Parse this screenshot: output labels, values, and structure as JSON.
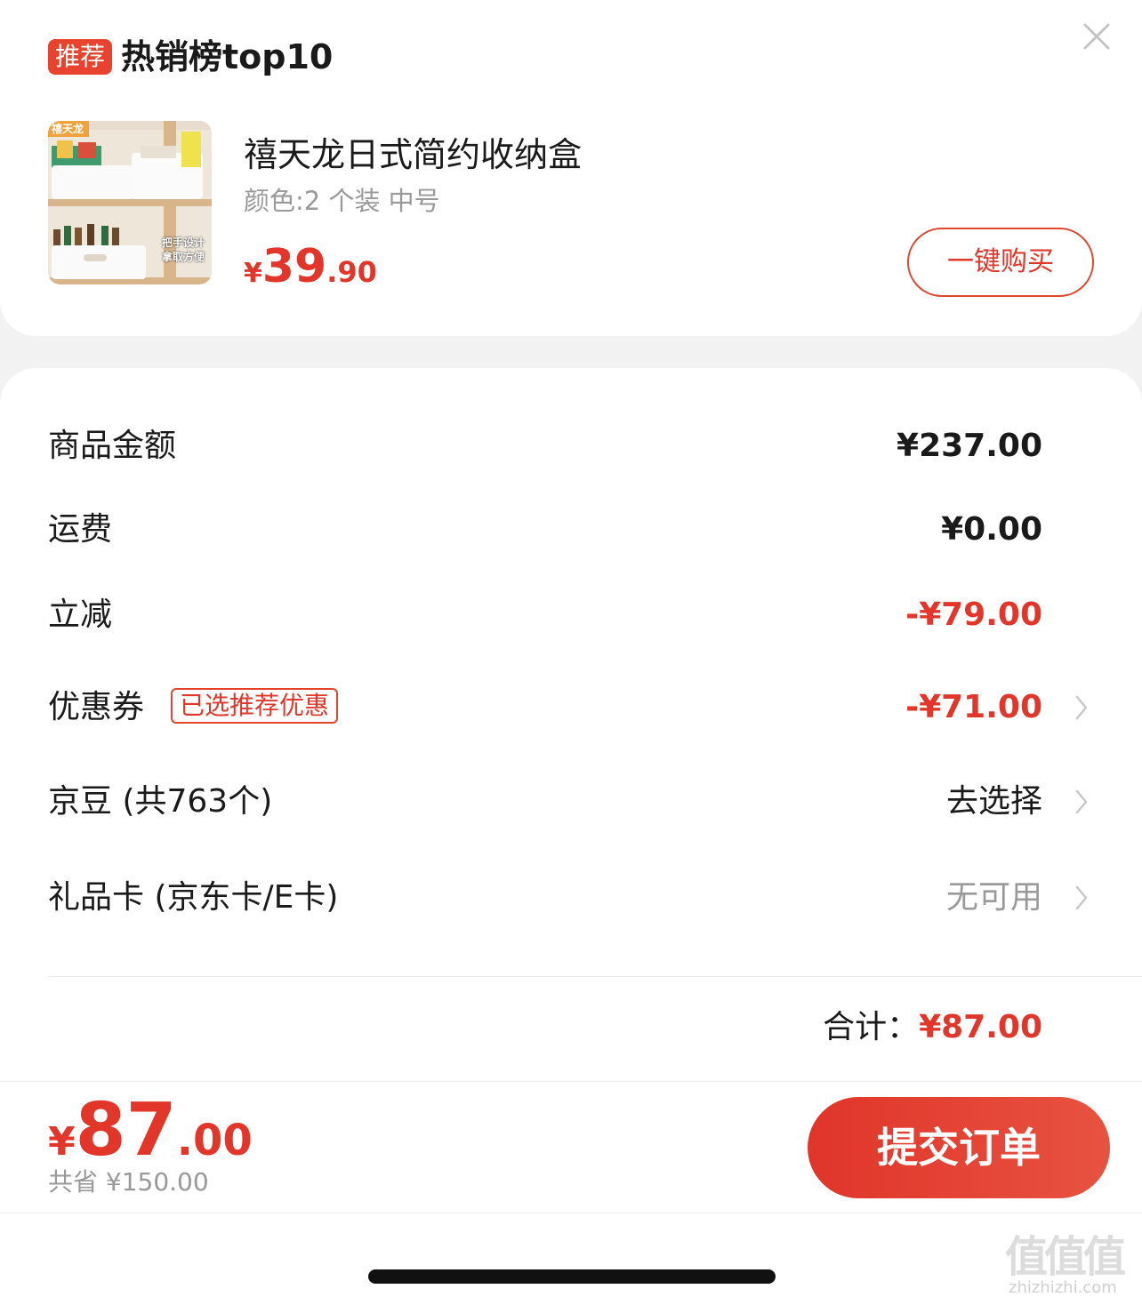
{
  "recommend": {
    "badge": "推荐",
    "title": "热销榜top10",
    "close_icon": "close-icon",
    "product": {
      "name": "禧天龙日式简约收纳盒",
      "spec": "颜色:2 个装  中号",
      "price_currency": "¥",
      "price_int": "39",
      "price_dec": ".90",
      "buy_label": "一键购买",
      "image": {
        "brand": "禧天龙",
        "caption1": "把手设计",
        "caption2": "拿取方便"
      }
    }
  },
  "order": {
    "rows": [
      {
        "label": "商品金额",
        "value": "¥237.00"
      },
      {
        "label": "运费",
        "value": "¥0.00"
      },
      {
        "label": "立减",
        "value": "-¥79.00"
      },
      {
        "label": "优惠券",
        "tag": "已选推荐优惠",
        "value": "-¥71.00"
      },
      {
        "label": "京豆 (共763个)",
        "value": "去选择"
      },
      {
        "label": "礼品卡 (京东卡/E卡)",
        "value": "无可用"
      }
    ],
    "total_label": "合计：",
    "total_value": "¥87.00"
  },
  "footer": {
    "price_currency": "¥",
    "price_int": "87",
    "price_dec": ".00",
    "saved": "共省 ¥150.00",
    "submit_label": "提交订单"
  },
  "watermark": {
    "glyphs": "值值值",
    "url": "zhizhizhi.com"
  },
  "colors": {
    "accent": "#e2362a",
    "background": "#f2f2f2",
    "muted": "#999999"
  }
}
